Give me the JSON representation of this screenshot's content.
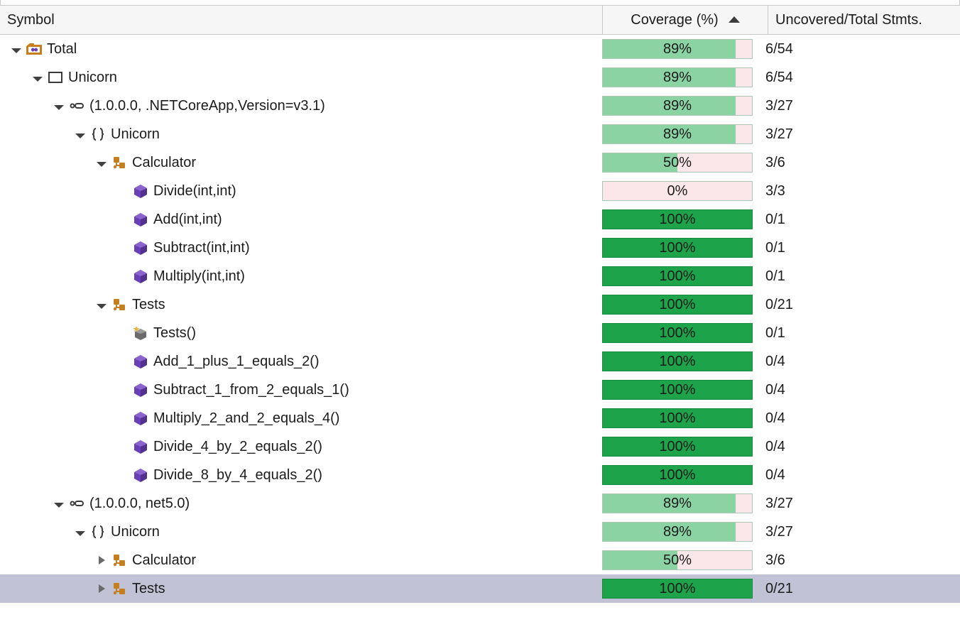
{
  "columns": {
    "symbol": "Symbol",
    "coverage": "Coverage (%)",
    "stmts": "Uncovered/Total Stmts."
  },
  "rows": [
    {
      "indent": 0,
      "expander": "open",
      "icon": "solution",
      "label": "Total",
      "coverage": 89,
      "bar_style": "light",
      "stmts": "6/54"
    },
    {
      "indent": 1,
      "expander": "open",
      "icon": "project",
      "label": "Unicorn",
      "coverage": 89,
      "bar_style": "light",
      "stmts": "6/54"
    },
    {
      "indent": 2,
      "expander": "open",
      "icon": "assembly",
      "label": "(1.0.0.0, .NETCoreApp,Version=v3.1)",
      "coverage": 89,
      "bar_style": "light",
      "stmts": "3/27"
    },
    {
      "indent": 3,
      "expander": "open",
      "icon": "namespace",
      "label": "Unicorn",
      "coverage": 89,
      "bar_style": "light",
      "stmts": "3/27"
    },
    {
      "indent": 4,
      "expander": "open",
      "icon": "class",
      "label": "Calculator",
      "coverage": 50,
      "bar_style": "light",
      "stmts": "3/6"
    },
    {
      "indent": 5,
      "expander": "none",
      "icon": "method",
      "label": "Divide(int,int)",
      "coverage": 0,
      "bar_style": "light",
      "stmts": "3/3"
    },
    {
      "indent": 5,
      "expander": "none",
      "icon": "method",
      "label": "Add(int,int)",
      "coverage": 100,
      "bar_style": "solid",
      "stmts": "0/1"
    },
    {
      "indent": 5,
      "expander": "none",
      "icon": "method",
      "label": "Subtract(int,int)",
      "coverage": 100,
      "bar_style": "solid",
      "stmts": "0/1"
    },
    {
      "indent": 5,
      "expander": "none",
      "icon": "method",
      "label": "Multiply(int,int)",
      "coverage": 100,
      "bar_style": "solid",
      "stmts": "0/1"
    },
    {
      "indent": 4,
      "expander": "open",
      "icon": "class",
      "label": "Tests",
      "coverage": 100,
      "bar_style": "solid",
      "stmts": "0/21"
    },
    {
      "indent": 5,
      "expander": "none",
      "icon": "ctor",
      "label": "Tests()",
      "coverage": 100,
      "bar_style": "solid",
      "stmts": "0/1"
    },
    {
      "indent": 5,
      "expander": "none",
      "icon": "method",
      "label": "Add_1_plus_1_equals_2()",
      "coverage": 100,
      "bar_style": "solid",
      "stmts": "0/4"
    },
    {
      "indent": 5,
      "expander": "none",
      "icon": "method",
      "label": "Subtract_1_from_2_equals_1()",
      "coverage": 100,
      "bar_style": "solid",
      "stmts": "0/4"
    },
    {
      "indent": 5,
      "expander": "none",
      "icon": "method",
      "label": "Multiply_2_and_2_equals_4()",
      "coverage": 100,
      "bar_style": "solid",
      "stmts": "0/4"
    },
    {
      "indent": 5,
      "expander": "none",
      "icon": "method",
      "label": "Divide_4_by_2_equals_2()",
      "coverage": 100,
      "bar_style": "solid",
      "stmts": "0/4"
    },
    {
      "indent": 5,
      "expander": "none",
      "icon": "method",
      "label": "Divide_8_by_4_equals_2()",
      "coverage": 100,
      "bar_style": "solid",
      "stmts": "0/4"
    },
    {
      "indent": 2,
      "expander": "open",
      "icon": "assembly",
      "label": "(1.0.0.0, net5.0)",
      "coverage": 89,
      "bar_style": "light",
      "stmts": "3/27"
    },
    {
      "indent": 3,
      "expander": "open",
      "icon": "namespace",
      "label": "Unicorn",
      "coverage": 89,
      "bar_style": "light",
      "stmts": "3/27"
    },
    {
      "indent": 4,
      "expander": "closed",
      "icon": "class",
      "label": "Calculator",
      "coverage": 50,
      "bar_style": "light",
      "stmts": "3/6"
    },
    {
      "indent": 4,
      "expander": "closed",
      "icon": "class",
      "label": "Tests",
      "coverage": 100,
      "bar_style": "solid",
      "stmts": "0/21",
      "selected": true
    }
  ]
}
